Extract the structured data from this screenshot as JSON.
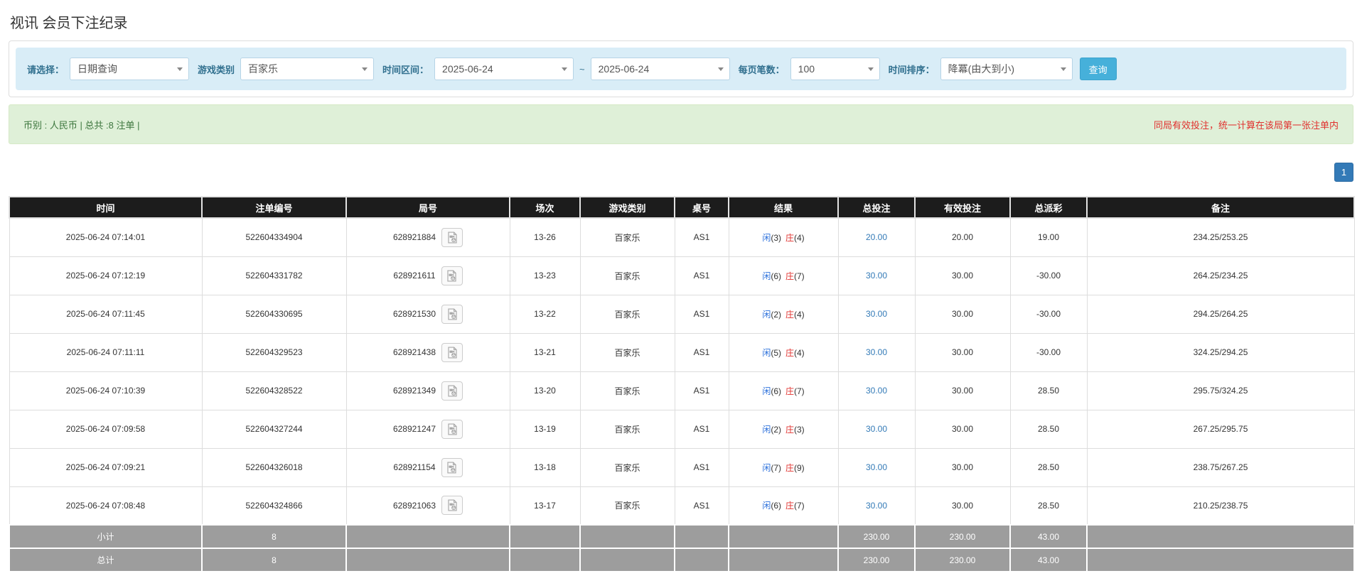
{
  "page": {
    "title": "视讯 会员下注纪录"
  },
  "colors": {
    "filter_bar_bg": "#d9edf7",
    "label_blue": "#31708f",
    "search_button_bg": "#46b0da",
    "summary_bar_bg": "#dff0d8",
    "summary_text_green": "#3c763d",
    "note_red": "#e0312e",
    "pagination_blue": "#337ab7",
    "header_bg": "#1c1c1c",
    "footer_row_bg": "#9d9d9d",
    "player_blue": "#2a6fdb",
    "banker_red": "#e0312e",
    "total_bet_link_blue": "#337ab7",
    "negative_payout_red": "#e0312e"
  },
  "icons": {
    "combo_caret": "chevron-down-icon",
    "round_media": "video-file-icon"
  },
  "filters": {
    "select_label": "请选择：",
    "select_value": "日期查询",
    "game_type_label": "游戏类别",
    "game_type_value": "百家乐",
    "time_range_label": "时间区间：",
    "date_from": "2025-06-24",
    "tilde": "~",
    "date_to": "2025-06-24",
    "page_size_label": "每页笔数：",
    "page_size_value": "100",
    "sort_label": "时间排序：",
    "sort_value": "降冪(由大到小)",
    "search_button": "查询"
  },
  "summary_bar": {
    "left_text": "币别 : 人民币 | 总共 :8 注单 |",
    "right_note": "同局有效投注，统一计算在该局第一张注单内"
  },
  "pagination": {
    "current": "1"
  },
  "table": {
    "headers": [
      "时间",
      "注单编号",
      "局号",
      "场次",
      "游戏类别",
      "桌号",
      "结果",
      "总投注",
      "有效投注",
      "总派彩",
      "备注"
    ],
    "rows": [
      {
        "time": "2025-06-24 07:14:01",
        "bet_id": "522604334904",
        "round_id": "628921884",
        "session": "13-26",
        "game": "百家乐",
        "table_no": "AS1",
        "result": {
          "p_label": "闲",
          "p_val": "(3)",
          "b_label": "庄",
          "b_val": "(4)"
        },
        "total_bet": "20.00",
        "valid_bet": "20.00",
        "payout": "19.00",
        "remark": "234.25/253.25"
      },
      {
        "time": "2025-06-24 07:12:19",
        "bet_id": "522604331782",
        "round_id": "628921611",
        "session": "13-23",
        "game": "百家乐",
        "table_no": "AS1",
        "result": {
          "p_label": "闲",
          "p_val": "(6)",
          "b_label": "庄",
          "b_val": "(7)"
        },
        "total_bet": "30.00",
        "valid_bet": "30.00",
        "payout": "-30.00",
        "remark": "264.25/234.25"
      },
      {
        "time": "2025-06-24 07:11:45",
        "bet_id": "522604330695",
        "round_id": "628921530",
        "session": "13-22",
        "game": "百家乐",
        "table_no": "AS1",
        "result": {
          "p_label": "闲",
          "p_val": "(2)",
          "b_label": "庄",
          "b_val": "(4)"
        },
        "total_bet": "30.00",
        "valid_bet": "30.00",
        "payout": "-30.00",
        "remark": "294.25/264.25"
      },
      {
        "time": "2025-06-24 07:11:11",
        "bet_id": "522604329523",
        "round_id": "628921438",
        "session": "13-21",
        "game": "百家乐",
        "table_no": "AS1",
        "result": {
          "p_label": "闲",
          "p_val": "(5)",
          "b_label": "庄",
          "b_val": "(4)"
        },
        "total_bet": "30.00",
        "valid_bet": "30.00",
        "payout": "-30.00",
        "remark": "324.25/294.25"
      },
      {
        "time": "2025-06-24 07:10:39",
        "bet_id": "522604328522",
        "round_id": "628921349",
        "session": "13-20",
        "game": "百家乐",
        "table_no": "AS1",
        "result": {
          "p_label": "闲",
          "p_val": "(6)",
          "b_label": "庄",
          "b_val": "(7)"
        },
        "total_bet": "30.00",
        "valid_bet": "30.00",
        "payout": "28.50",
        "remark": "295.75/324.25"
      },
      {
        "time": "2025-06-24 07:09:58",
        "bet_id": "522604327244",
        "round_id": "628921247",
        "session": "13-19",
        "game": "百家乐",
        "table_no": "AS1",
        "result": {
          "p_label": "闲",
          "p_val": "(2)",
          "b_label": "庄",
          "b_val": "(3)"
        },
        "total_bet": "30.00",
        "valid_bet": "30.00",
        "payout": "28.50",
        "remark": "267.25/295.75"
      },
      {
        "time": "2025-06-24 07:09:21",
        "bet_id": "522604326018",
        "round_id": "628921154",
        "session": "13-18",
        "game": "百家乐",
        "table_no": "AS1",
        "result": {
          "p_label": "闲",
          "p_val": "(7)",
          "b_label": "庄",
          "b_val": "(9)"
        },
        "total_bet": "30.00",
        "valid_bet": "30.00",
        "payout": "28.50",
        "remark": "238.75/267.25"
      },
      {
        "time": "2025-06-24 07:08:48",
        "bet_id": "522604324866",
        "round_id": "628921063",
        "session": "13-17",
        "game": "百家乐",
        "table_no": "AS1",
        "result": {
          "p_label": "闲",
          "p_val": "(6)",
          "b_label": "庄",
          "b_val": "(7)"
        },
        "total_bet": "30.00",
        "valid_bet": "30.00",
        "payout": "28.50",
        "remark": "210.25/238.75"
      }
    ],
    "subtotal": {
      "label": "小计",
      "count": "8",
      "total_bet": "230.00",
      "valid_bet": "230.00",
      "payout": "43.00"
    },
    "total": {
      "label": "总计",
      "count": "8",
      "total_bet": "230.00",
      "valid_bet": "230.00",
      "payout": "43.00"
    }
  }
}
